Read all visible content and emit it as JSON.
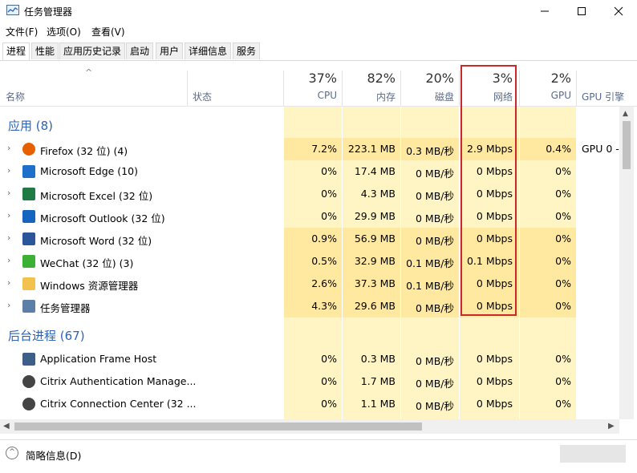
{
  "window": {
    "title": "任务管理器"
  },
  "menu": [
    "文件(F)",
    "选项(O)",
    "查看(V)"
  ],
  "tabs": [
    "进程",
    "性能",
    "应用历史记录",
    "启动",
    "用户",
    "详细信息",
    "服务"
  ],
  "columns": {
    "name": "名称",
    "status": "状态",
    "cpu": {
      "pct": "37%",
      "label": "CPU"
    },
    "mem": {
      "pct": "82%",
      "label": "内存"
    },
    "disk": {
      "pct": "20%",
      "label": "磁盘"
    },
    "net": {
      "pct": "3%",
      "label": "网络"
    },
    "gpu": {
      "pct": "2%",
      "label": "GPU"
    },
    "gpu_engine": "GPU 引擎"
  },
  "groups": {
    "apps": "应用 (8)",
    "background": "后台进程 (67)"
  },
  "apps": [
    {
      "name": "Firefox (32 位) (4)",
      "cpu": "7.2%",
      "mem": "223.1 MB",
      "disk": "0.3 MB/秒",
      "net": "2.9 Mbps",
      "gpu": "0.4%",
      "gpu_engine": "GPU 0 -",
      "icon": "firefox-icon"
    },
    {
      "name": "Microsoft Edge (10)",
      "cpu": "0%",
      "mem": "17.4 MB",
      "disk": "0 MB/秒",
      "net": "0 Mbps",
      "gpu": "0%",
      "gpu_engine": "",
      "icon": "edge-icon"
    },
    {
      "name": "Microsoft Excel (32 位)",
      "cpu": "0%",
      "mem": "4.3 MB",
      "disk": "0 MB/秒",
      "net": "0 Mbps",
      "gpu": "0%",
      "gpu_engine": "",
      "icon": "excel-icon"
    },
    {
      "name": "Microsoft Outlook (32 位)",
      "cpu": "0%",
      "mem": "29.9 MB",
      "disk": "0 MB/秒",
      "net": "0 Mbps",
      "gpu": "0%",
      "gpu_engine": "",
      "icon": "outlook-icon"
    },
    {
      "name": "Microsoft Word (32 位)",
      "cpu": "0.9%",
      "mem": "56.9 MB",
      "disk": "0 MB/秒",
      "net": "0 Mbps",
      "gpu": "0%",
      "gpu_engine": "",
      "icon": "word-icon"
    },
    {
      "name": "WeChat (32 位) (3)",
      "cpu": "0.5%",
      "mem": "32.9 MB",
      "disk": "0.1 MB/秒",
      "net": "0.1 Mbps",
      "gpu": "0%",
      "gpu_engine": "",
      "icon": "wechat-icon"
    },
    {
      "name": "Windows 资源管理器",
      "cpu": "2.6%",
      "mem": "37.3 MB",
      "disk": "0.1 MB/秒",
      "net": "0 Mbps",
      "gpu": "0%",
      "gpu_engine": "",
      "icon": "folder-icon"
    },
    {
      "name": "任务管理器",
      "cpu": "4.3%",
      "mem": "29.6 MB",
      "disk": "0 MB/秒",
      "net": "0 Mbps",
      "gpu": "0%",
      "gpu_engine": "",
      "icon": "task-manager-icon"
    }
  ],
  "background": [
    {
      "name": "Application Frame Host",
      "cpu": "0%",
      "mem": "0.3 MB",
      "disk": "0 MB/秒",
      "net": "0 Mbps",
      "gpu": "0%",
      "icon": "app-frame-icon"
    },
    {
      "name": "Citrix Authentication Manage...",
      "cpu": "0%",
      "mem": "1.7 MB",
      "disk": "0 MB/秒",
      "net": "0 Mbps",
      "gpu": "0%",
      "icon": "citrix-icon"
    },
    {
      "name": "Citrix Connection Center (32 ...",
      "cpu": "0%",
      "mem": "1.1 MB",
      "disk": "0 MB/秒",
      "net": "0 Mbps",
      "gpu": "0%",
      "icon": "citrix-icon"
    }
  ],
  "footer": {
    "label": "简略信息(D)"
  },
  "colors": {
    "accent": "#2e63b5",
    "highlight": "#c9282d",
    "heat_light": "#fff4c4",
    "heat_mid": "#ffe8a0"
  }
}
